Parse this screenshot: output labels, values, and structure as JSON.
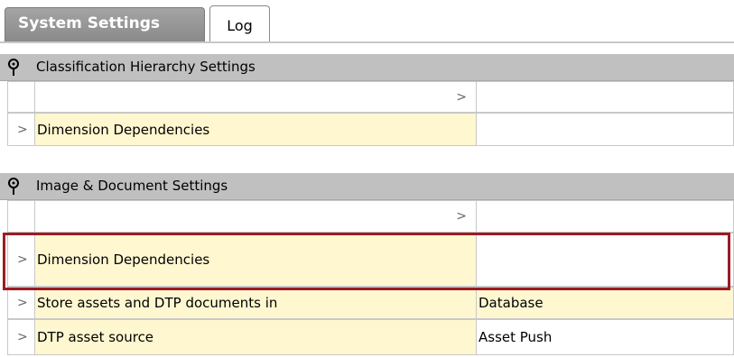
{
  "tabs": [
    {
      "label": "System Settings",
      "active": true
    },
    {
      "label": "Log",
      "active": false
    }
  ],
  "sections": [
    {
      "title": "Classification Hierarchy Settings",
      "rows": [
        {
          "name": "",
          "value": "",
          "gutter_chevron": "",
          "name_chevron": ">"
        },
        {
          "name": "Dimension Dependencies",
          "value": "",
          "gutter_chevron": ">",
          "name_chevron": ""
        }
      ]
    },
    {
      "title": "Image & Document Settings",
      "rows": [
        {
          "name": "",
          "value": "",
          "gutter_chevron": "",
          "name_chevron": ">"
        },
        {
          "name": "Dimension Dependencies",
          "value": "",
          "gutter_chevron": ">",
          "name_chevron": ""
        },
        {
          "name": "Store assets and DTP documents in",
          "value": "Database",
          "gutter_chevron": ">",
          "name_chevron": ""
        },
        {
          "name": "DTP asset source",
          "value": "Asset Push",
          "gutter_chevron": ">",
          "name_chevron": ""
        }
      ]
    }
  ],
  "colors": {
    "tab_active_bg": "#9a9a9a",
    "section_header_bg": "#c0c0c0",
    "property_name_bg": "#fff7d0",
    "highlight_border": "#9b1c24"
  }
}
